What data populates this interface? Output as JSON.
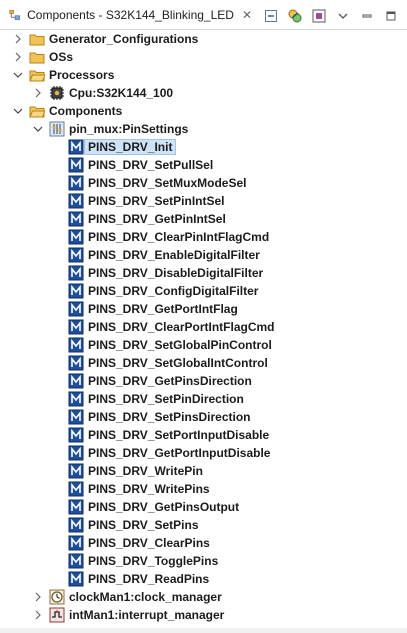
{
  "view": {
    "title": "Components - S32K144_Blinking_LED",
    "close_symbol": "✕",
    "toolbar": [
      "collapse-all-icon",
      "link-with-editor-icon",
      "component-settings-icon",
      "view-menu-chevron-icon",
      "minimize-icon",
      "maximize-icon"
    ]
  },
  "tree": {
    "generator_configurations": "Generator_Configurations",
    "oss": "OSs",
    "processors": "Processors",
    "cpu": "Cpu:S32K144_100",
    "components": "Components",
    "pin_mux": "pin_mux:PinSettings",
    "methods": [
      "PINS_DRV_Init",
      "PINS_DRV_SetPullSel",
      "PINS_DRV_SetMuxModeSel",
      "PINS_DRV_SetPinIntSel",
      "PINS_DRV_GetPinIntSel",
      "PINS_DRV_ClearPinIntFlagCmd",
      "PINS_DRV_EnableDigitalFilter",
      "PINS_DRV_DisableDigitalFilter",
      "PINS_DRV_ConfigDigitalFilter",
      "PINS_DRV_GetPortIntFlag",
      "PINS_DRV_ClearPortIntFlagCmd",
      "PINS_DRV_SetGlobalPinControl",
      "PINS_DRV_SetGlobalIntControl",
      "PINS_DRV_GetPinsDirection",
      "PINS_DRV_SetPinDirection",
      "PINS_DRV_SetPinsDirection",
      "PINS_DRV_SetPortInputDisable",
      "PINS_DRV_GetPortInputDisable",
      "PINS_DRV_WritePin",
      "PINS_DRV_WritePins",
      "PINS_DRV_GetPinsOutput",
      "PINS_DRV_SetPins",
      "PINS_DRV_ClearPins",
      "PINS_DRV_TogglePins",
      "PINS_DRV_ReadPins"
    ],
    "clock_manager": "clockMan1:clock_manager",
    "interrupt_manager": "intMan1:interrupt_manager"
  }
}
